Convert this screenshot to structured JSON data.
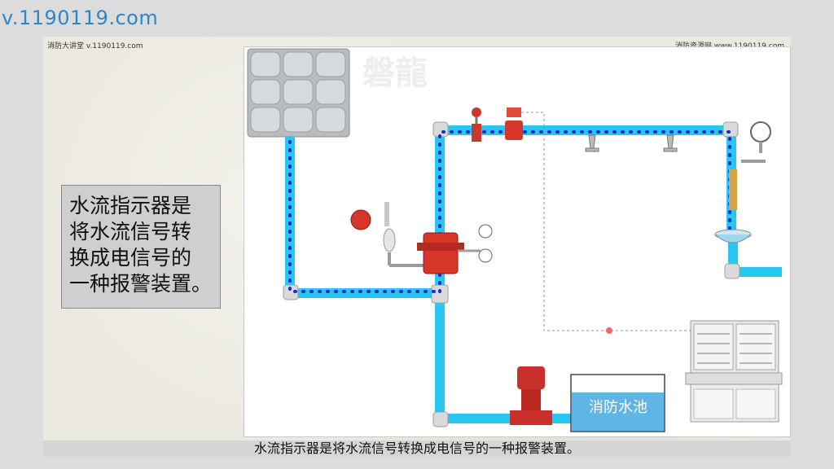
{
  "site_url": "v.1190119.com",
  "header": {
    "left_note": "消防大讲堂 v.1190119.com",
    "right_note": "消防资源网 www.1190119.com"
  },
  "explanation": {
    "lines": [
      "水流指示器是",
      "将水流信号转",
      "换成电信号的",
      "一种报警装置。"
    ]
  },
  "diagram": {
    "pool_label": "消防水池",
    "watermark": "磐龍",
    "colors": {
      "pipe": "#29c6f2",
      "flow_dots": "#1a2fd0",
      "valve_red": "#d7372a",
      "signal_line": "#999999",
      "pool_fill": "#5fb6e6"
    }
  },
  "caption": "水流指示器是将水流信号转换成电信号的一种报警装置。"
}
